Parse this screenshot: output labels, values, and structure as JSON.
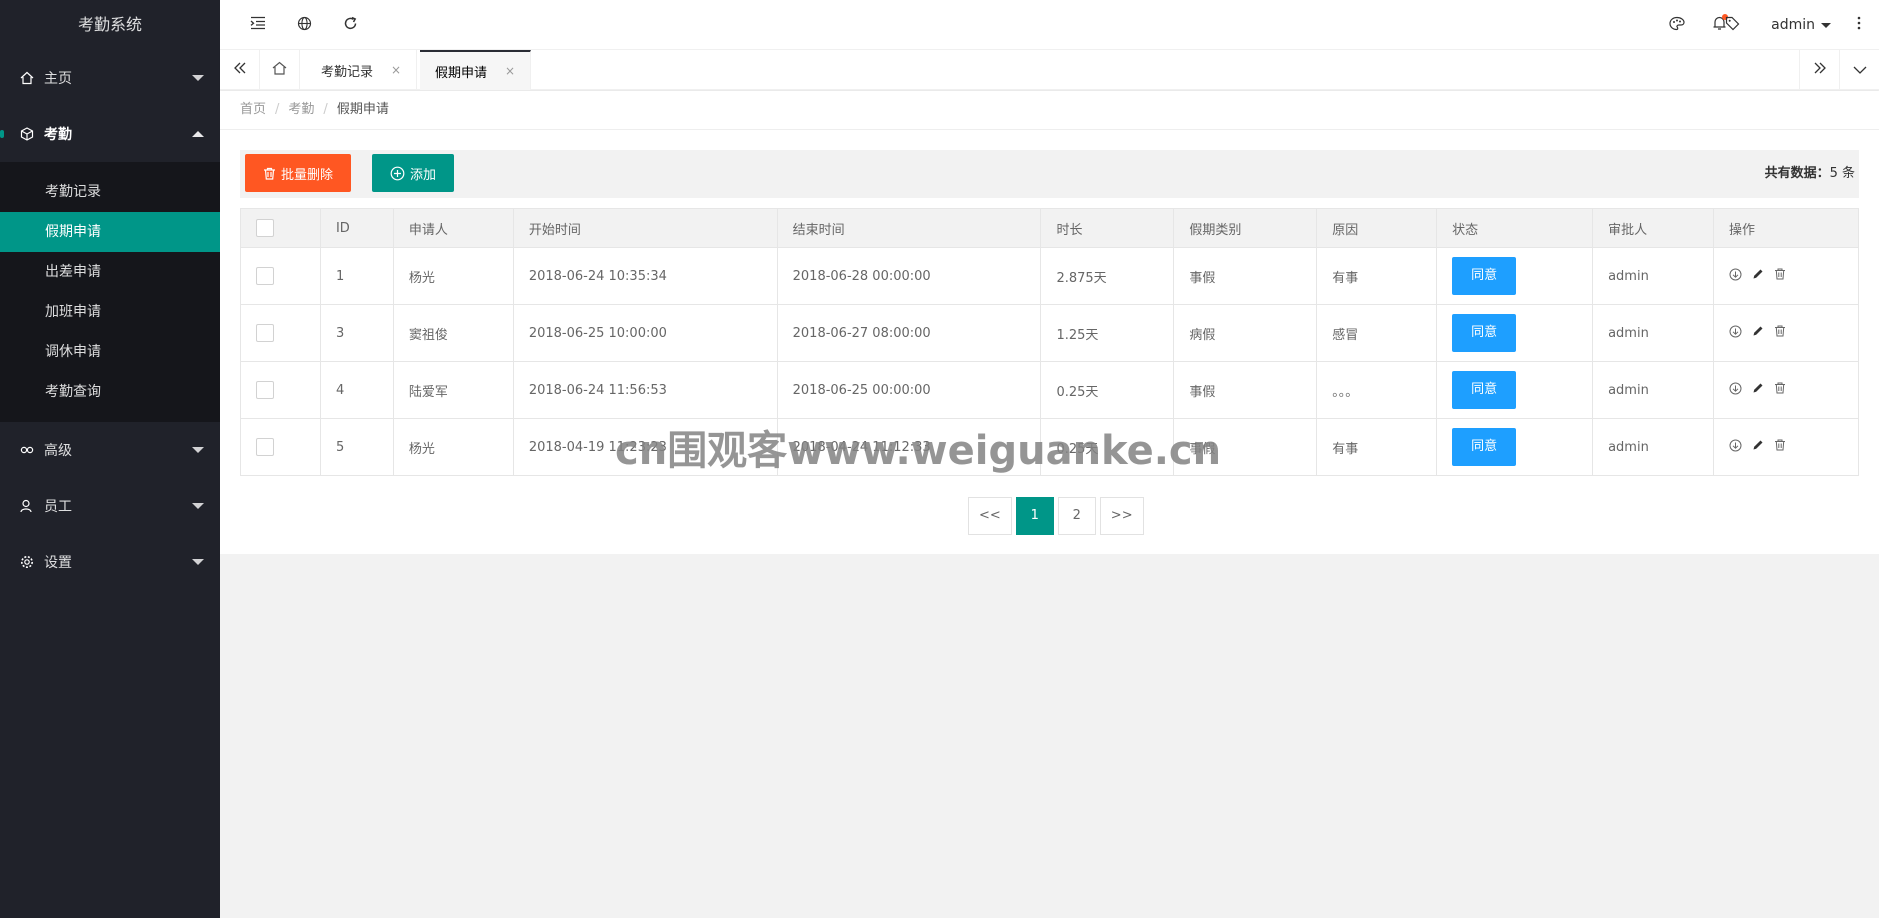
{
  "sidebar": {
    "logo": "考勤系统",
    "groups": [
      {
        "label": "主页"
      },
      {
        "label": "考勤"
      },
      {
        "label": "高级"
      },
      {
        "label": "员工"
      },
      {
        "label": "设置"
      }
    ],
    "submenu": [
      "考勤记录",
      "假期申请",
      "出差申请",
      "加班申请",
      "调休申请",
      "考勤查询"
    ]
  },
  "header": {
    "user": "admin"
  },
  "tabs": [
    {
      "label": "考勤记录",
      "close": "×"
    },
    {
      "label": "假期申请",
      "close": "×"
    }
  ],
  "breadcrumb": [
    "首页",
    "考勤",
    "假期申请"
  ],
  "breadcrumb_sep": "/",
  "toolbar": {
    "batch_delete": "批量删除",
    "add": "添加",
    "total_label": "共有数据：",
    "total_count": "5",
    "total_unit": " 条"
  },
  "table": {
    "columns": [
      "ID",
      "申请人",
      "开始时间",
      "结束时间",
      "时长",
      "假期类别",
      "原因",
      "状态",
      "审批人",
      "操作"
    ],
    "rows": [
      {
        "id": "1",
        "applicant": "杨光",
        "start": "2018-06-24 10:35:34",
        "end": "2018-06-28 00:00:00",
        "duration": "2.875天",
        "type": "事假",
        "reason": "有事",
        "status": "同意",
        "approver": "admin"
      },
      {
        "id": "3",
        "applicant": "窦祖俊",
        "start": "2018-06-25 10:00:00",
        "end": "2018-06-27 08:00:00",
        "duration": "1.25天",
        "type": "病假",
        "reason": "感冒",
        "status": "同意",
        "approver": "admin"
      },
      {
        "id": "4",
        "applicant": "陆爱军",
        "start": "2018-06-24 11:56:53",
        "end": "2018-06-25 00:00:00",
        "duration": "0.25天",
        "type": "事假",
        "reason": "。。。",
        "status": "同意",
        "approver": "admin"
      },
      {
        "id": "5",
        "applicant": "杨光",
        "start": "2018-04-19 11:23:23",
        "end": "2018-04-24 11:12:33",
        "duration": "0.25天",
        "type": "事假",
        "reason": "有事",
        "status": "同意",
        "approver": "admin"
      }
    ]
  },
  "pager": {
    "prev": "<<",
    "pages": [
      "1",
      "2"
    ],
    "next": ">>"
  },
  "watermark": "cn围观客www.weiguanke.cn",
  "colors": {
    "sidebar_bg": "#20222a",
    "submenu_bg": "#15161b",
    "accent": "#009688",
    "danger": "#ff5722",
    "agree_blue": "#1E9FFF"
  }
}
